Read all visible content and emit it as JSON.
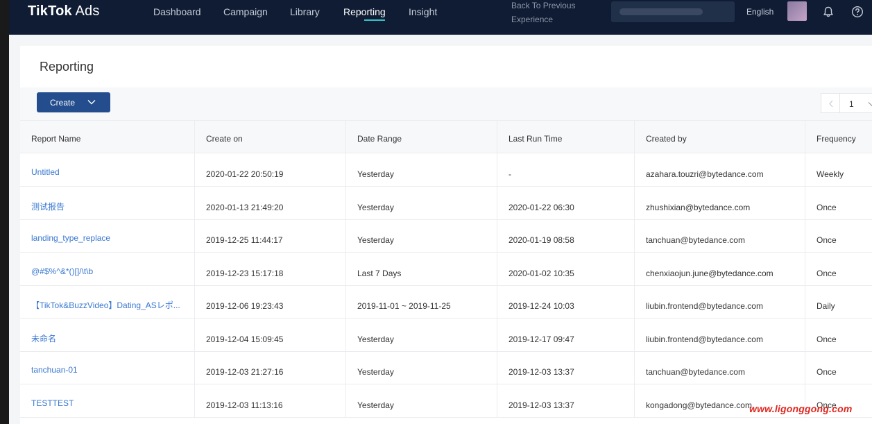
{
  "brand": {
    "name_bold": "TikTok",
    "name_light": "Ads"
  },
  "nav": {
    "items": [
      {
        "label": "Dashboard"
      },
      {
        "label": "Campaign"
      },
      {
        "label": "Library"
      },
      {
        "label": "Reporting"
      },
      {
        "label": "Insight"
      }
    ],
    "active": "Reporting",
    "back_line1": "Back To Previous",
    "back_line2": "Experience",
    "language": "English"
  },
  "page": {
    "title": "Reporting",
    "create_label": "Create",
    "current_page": "1"
  },
  "table": {
    "columns": [
      "Report Name",
      "Create on",
      "Date Range",
      "Last Run Time",
      "Created by",
      "Frequency"
    ],
    "rows": [
      [
        "Untitled",
        "2020-01-22 20:50:19",
        "Yesterday",
        "-",
        "azahara.touzri@bytedance.com",
        "Weekly"
      ],
      [
        "测试报告",
        "2020-01-13 21:49:20",
        "Yesterday",
        "2020-01-22 06:30",
        "zhushixian@bytedance.com",
        "Once"
      ],
      [
        "landing_type_replace",
        "2019-12-25 11:44:17",
        "Yesterday",
        "2020-01-19 08:58",
        "tanchuan@bytedance.com",
        "Once"
      ],
      [
        "@#$%^&*()[]/\\t\\b",
        "2019-12-23 15:17:18",
        "Last 7 Days",
        "2020-01-02 10:35",
        "chenxiaojun.june@bytedance.com",
        "Once"
      ],
      [
        "【TikTok&BuzzVideo】Dating_ASレポ...",
        "2019-12-06 19:23:43",
        "2019-11-01 ~ 2019-11-25",
        "2019-12-24 10:03",
        "liubin.frontend@bytedance.com",
        "Daily"
      ],
      [
        "未命名",
        "2019-12-04 15:09:45",
        "Yesterday",
        "2019-12-17 09:47",
        "liubin.frontend@bytedance.com",
        "Once"
      ],
      [
        "tanchuan-01",
        "2019-12-03 21:27:16",
        "Yesterday",
        "2019-12-03 13:37",
        "tanchuan@bytedance.com",
        "Once"
      ],
      [
        "TESTTEST",
        "2019-12-03 11:13:16",
        "Yesterday",
        "2019-12-03 13:37",
        "kongadong@bytedance.com",
        "Once"
      ]
    ]
  },
  "watermark": "www.ligonggong.com",
  "colors": {
    "nav_bg": "#0f1c33",
    "accent": "#2fc5c9",
    "button": "#244d8e",
    "link": "#3a78d1"
  },
  "icons": [
    "chevron-down-icon",
    "bell-icon",
    "help-icon",
    "chevron-left-icon"
  ]
}
